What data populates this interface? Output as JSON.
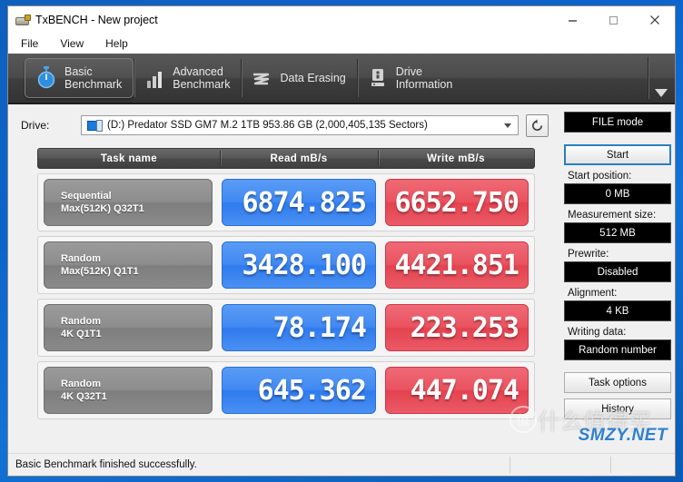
{
  "window": {
    "title": "TxBENCH - New project",
    "app_icon": "usb-drive-icon",
    "controls": {
      "minimize": "–",
      "maximize": "□",
      "close": "✕"
    }
  },
  "menu": {
    "items": [
      "File",
      "View",
      "Help"
    ]
  },
  "tabs": [
    {
      "label": "Basic\nBenchmark",
      "icon": "stopwatch-icon",
      "active": true
    },
    {
      "label": "Advanced\nBenchmark",
      "icon": "bar-chart-icon",
      "active": false
    },
    {
      "label": "Data Erasing",
      "icon": "shred-wave-icon",
      "active": false
    },
    {
      "label": "Drive\nInformation",
      "icon": "drive-info-icon",
      "active": false
    }
  ],
  "tab_overflow_icon": "chevron-down-icon",
  "drive": {
    "label": "Drive:",
    "value": "(D:) Predator SSD GM7 M.2 1TB  953.86 GB (2,000,405,135 Sectors)",
    "icon": "disk-drive-icon",
    "refresh_icon": "refresh-icon"
  },
  "table": {
    "headers": [
      "Task name",
      "Read mB/s",
      "Write mB/s"
    ],
    "rows": [
      {
        "task_line1": "Sequential",
        "task_line2": "Max(512K) Q32T1",
        "read": "6874.825",
        "write": "6652.750"
      },
      {
        "task_line1": "Random",
        "task_line2": "Max(512K) Q1T1",
        "read": "3428.100",
        "write": "4421.851"
      },
      {
        "task_line1": "Random",
        "task_line2": "4K Q1T1",
        "read": "78.174",
        "write": "223.253"
      },
      {
        "task_line1": "Random",
        "task_line2": "4K Q32T1",
        "read": "645.362",
        "write": "447.074"
      }
    ]
  },
  "sidebar": {
    "mode_button": "FILE mode",
    "start_button": "Start",
    "fields": [
      {
        "label": "Start position:",
        "value": "0 MB"
      },
      {
        "label": "Measurement size:",
        "value": "512 MB"
      },
      {
        "label": "Prewrite:",
        "value": "Disabled"
      },
      {
        "label": "Alignment:",
        "value": "4 KB"
      },
      {
        "label": "Writing data:",
        "value": "Random number"
      }
    ],
    "task_options_button": "Task options",
    "history_button": "History"
  },
  "status": {
    "message": "Basic Benchmark finished successfully."
  },
  "watermark": {
    "cn": "什么值得买",
    "badge": "值",
    "site": "SMZY.NET"
  },
  "colors": {
    "read_blue": "#4189f2",
    "write_red": "#e9535f",
    "desktop_blue": "#0c63c9",
    "tab_dark": "#4b4b4b",
    "accent_focus": "#2a7fbe"
  }
}
